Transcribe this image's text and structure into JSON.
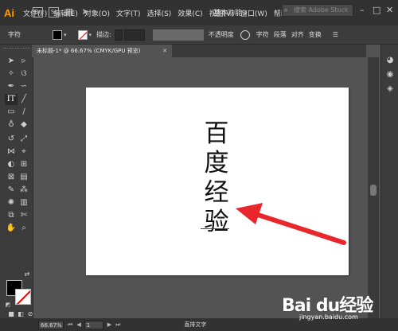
{
  "app": {
    "logo": "Ai"
  },
  "menu": {
    "items": [
      "文件(F)",
      "编辑(E)",
      "对象(O)",
      "文字(T)",
      "选择(S)",
      "效果(C)",
      "视图(V)",
      "窗口(W)",
      "帮助(H)"
    ],
    "br_label": "Br",
    "st_label": "St",
    "workspace": "基本功能",
    "stock_placeholder": "搜索 Adobe Stock"
  },
  "control": {
    "mode_label": "字符",
    "stroke_label": "描边:",
    "opacity_label": "不透明度",
    "links": [
      "字符",
      "段落",
      "对齐",
      "变换"
    ]
  },
  "document": {
    "tab_title": "未标题-1* @ 66.67% (CMYK/GPU 预览)"
  },
  "artboard": {
    "chars": [
      "百",
      "度",
      "经",
      "验"
    ]
  },
  "status": {
    "zoom": "66.67%",
    "page": "1",
    "tool": "直排文字"
  },
  "watermark": {
    "brand": "Bai du经验",
    "site": "jingyan.baidu.com"
  },
  "colors": {
    "accent": "#ff9a00",
    "arrow": "#e8262b"
  }
}
